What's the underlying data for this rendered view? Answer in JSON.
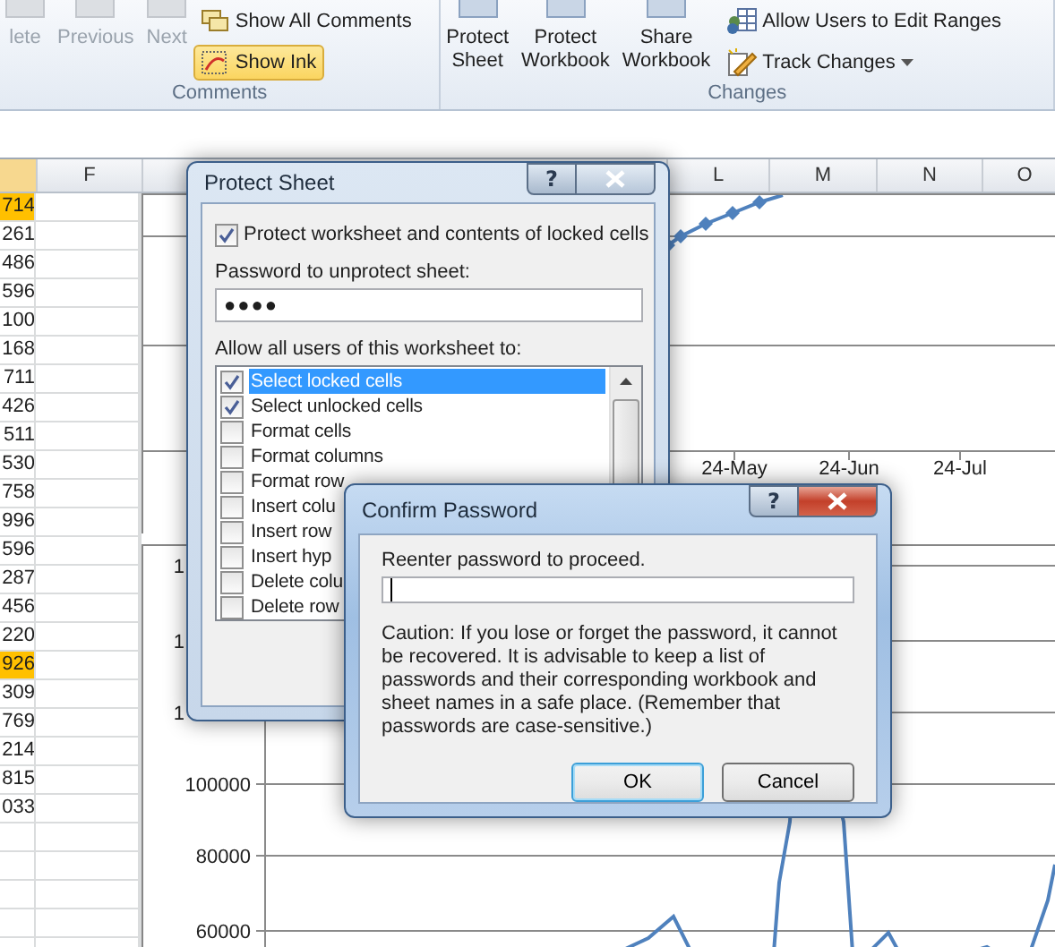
{
  "ribbon": {
    "groups": [
      {
        "label": "Comments",
        "buttons": [
          {
            "label": "lete",
            "kind": "large",
            "disabled": true,
            "selected": false
          },
          {
            "label": "Previous",
            "kind": "large",
            "disabled": true,
            "selected": false
          },
          {
            "label": "Next",
            "kind": "large",
            "disabled": true,
            "selected": false
          },
          {
            "label": "Show All Comments",
            "kind": "small",
            "disabled": false,
            "selected": false
          },
          {
            "label": "Show Ink",
            "kind": "small",
            "disabled": false,
            "selected": true
          }
        ]
      },
      {
        "label": "Changes",
        "buttons": [
          {
            "label": "Protect Sheet",
            "kind": "large",
            "disabled": false,
            "selected": false
          },
          {
            "label": "Protect Workbook",
            "kind": "large",
            "disabled": false,
            "selected": false
          },
          {
            "label": "Share Workbook",
            "kind": "large",
            "disabled": false,
            "selected": false
          },
          {
            "label": "Allow Users to Edit Ranges",
            "kind": "small",
            "disabled": false,
            "selected": false
          },
          {
            "label": "Track Changes",
            "kind": "small",
            "dropdown": true,
            "disabled": false,
            "selected": false
          }
        ]
      }
    ]
  },
  "sheet": {
    "column_headers": [
      {
        "label": "F"
      },
      {
        "label": "L"
      },
      {
        "label": "M"
      },
      {
        "label": "N"
      },
      {
        "label": "O"
      }
    ],
    "column_e": [
      {
        "text": "714",
        "highlighted": true
      },
      {
        "text": "261",
        "highlighted": false
      },
      {
        "text": "486",
        "highlighted": false
      },
      {
        "text": "596",
        "highlighted": false
      },
      {
        "text": "100",
        "highlighted": false
      },
      {
        "text": "168",
        "highlighted": false
      },
      {
        "text": "711",
        "highlighted": false
      },
      {
        "text": "426",
        "highlighted": false
      },
      {
        "text": "511",
        "highlighted": false
      },
      {
        "text": "530",
        "highlighted": false
      },
      {
        "text": "758",
        "highlighted": false
      },
      {
        "text": "996",
        "highlighted": false
      },
      {
        "text": "596",
        "highlighted": false
      },
      {
        "text": "287",
        "highlighted": false
      },
      {
        "text": "456",
        "highlighted": false
      },
      {
        "text": "220",
        "highlighted": false
      },
      {
        "text": "926",
        "highlighted": true
      },
      {
        "text": "309",
        "highlighted": false
      },
      {
        "text": "769",
        "highlighted": false
      },
      {
        "text": "214",
        "highlighted": false
      },
      {
        "text": "815",
        "highlighted": false
      },
      {
        "text": "033",
        "highlighted": false
      }
    ],
    "top_chart": {
      "x_tick_labels": [
        "24-May",
        "24-Jun",
        "24-Jul"
      ]
    },
    "bottom_chart": {
      "y_tick_labels": [
        "1",
        "1",
        "1",
        "100000",
        "80000",
        "60000"
      ]
    }
  },
  "protect_sheet_dialog": {
    "title": "Protect Sheet",
    "active": false,
    "help_button": "?",
    "protect_checkbox": {
      "label": "Protect worksheet and contents of locked cells",
      "checked": true
    },
    "password": {
      "label": "Password to unprotect sheet:",
      "value": "●●●●"
    },
    "permissions_label": "Allow all users of this worksheet to:",
    "permissions": [
      {
        "label": "Select locked cells",
        "checked": true,
        "selected": true
      },
      {
        "label": "Select unlocked cells",
        "checked": true,
        "selected": false
      },
      {
        "label": "Format cells",
        "checked": false,
        "selected": false
      },
      {
        "label": "Format columns",
        "checked": false,
        "selected": false
      },
      {
        "label": "Format row",
        "checked": false,
        "selected": false
      },
      {
        "label": "Insert colu",
        "checked": false,
        "selected": false
      },
      {
        "label": "Insert row",
        "checked": false,
        "selected": false
      },
      {
        "label": "Insert hyp",
        "checked": false,
        "selected": false
      },
      {
        "label": "Delete colu",
        "checked": false,
        "selected": false
      },
      {
        "label": "Delete row",
        "checked": false,
        "selected": false
      }
    ]
  },
  "confirm_password_dialog": {
    "title": "Confirm Password",
    "active": true,
    "help_button": "?",
    "prompt": "Reenter password to proceed.",
    "caution": "Caution: If you lose or forget the password, it cannot be recovered. It is advisable to keep a list of passwords and their corresponding workbook and sheet names in a safe place.  (Remember that passwords are case-sensitive.)",
    "buttons": [
      {
        "label": "OK",
        "default": true
      },
      {
        "label": "Cancel",
        "default": false
      }
    ]
  }
}
